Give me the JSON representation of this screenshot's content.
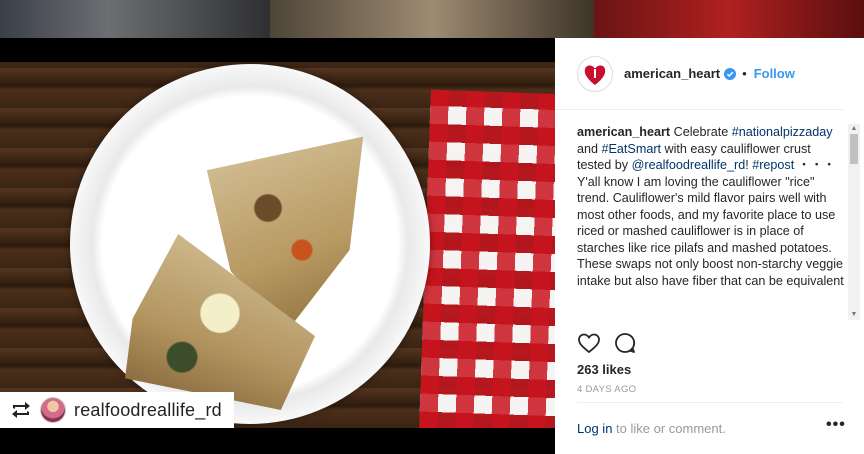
{
  "post": {
    "username": "american_heart",
    "follow_label": "Follow",
    "separator": "•",
    "caption": {
      "user": "american_heart",
      "p1": " Celebrate ",
      "tag1": "#nationalpizzaday",
      "p2": " and ",
      "tag2": "#EatSmart",
      "p3": " with easy cauliflower crust tested by ",
      "mention": "@realfoodreallife_rd",
      "p4": "! ",
      "tag3": "#repost",
      "p5": " ・・・ Y'all know I am loving the cauliflower \"rice\" trend. Cauliflower's mild flavor pairs well with most other foods, and my favorite place to use riced or mashed cauliflower is in place of starches like rice pilafs and mashed potatoes. These swaps not only boost non-starchy veggie intake but also have fiber that can be equivalent"
    },
    "likes": "263 likes",
    "time": "4 DAYS AGO",
    "login_link": "Log in",
    "login_rest": " to like or comment.",
    "more_label": "•••"
  },
  "photo": {
    "repost_credit": "realfoodreallife_rd"
  },
  "icons": {
    "verified": "verified-badge-icon",
    "like": "heart-icon",
    "comment": "comment-icon",
    "repost": "repost-icon"
  },
  "colors": {
    "link": "#3897f0",
    "hashtag": "#003569",
    "brand_red": "#c8102e"
  }
}
